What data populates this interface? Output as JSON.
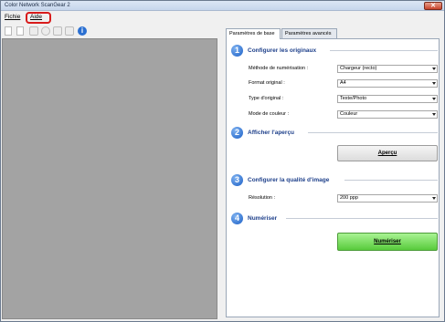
{
  "window": {
    "title": "Color Network ScanGear 2",
    "close_symbol": "✕"
  },
  "menu": {
    "file": "Fichie",
    "help": "Aide"
  },
  "toolbar": {
    "icons": [
      "new-doc-icon",
      "new-doc-icon",
      "hand-icon",
      "zoom-icon",
      "copy-icon",
      "save-icon",
      "info-icon"
    ],
    "info_glyph": "i"
  },
  "tabs": {
    "basic": "Paramètres de base",
    "advanced": "Paramètres avancés"
  },
  "sections": [
    {
      "number": "1",
      "title": "Configurer les originaux"
    },
    {
      "number": "2",
      "title": "Afficher l'aperçu"
    },
    {
      "number": "3",
      "title": "Configurer la qualité d'image"
    },
    {
      "number": "4",
      "title": "Numériser"
    }
  ],
  "originals": {
    "scan_method_label": "Méthode de numérisation :",
    "scan_method_value": "Chargeur (recto)",
    "format_label": "Format original :",
    "format_value": "A4",
    "type_label": "Type d'original :",
    "type_value": "Texte/Photo",
    "color_label": "Mode de couleur :",
    "color_value": "Couleur"
  },
  "preview": {
    "button_label": "Aperçu"
  },
  "quality": {
    "resolution_label": "Résolution :",
    "resolution_value": "200 ppp"
  },
  "scan": {
    "button_label": "Numériser"
  },
  "colors": {
    "accent": "#1b5fc6",
    "scan_button": "#58cb3c",
    "highlight": "#d81b1b"
  }
}
